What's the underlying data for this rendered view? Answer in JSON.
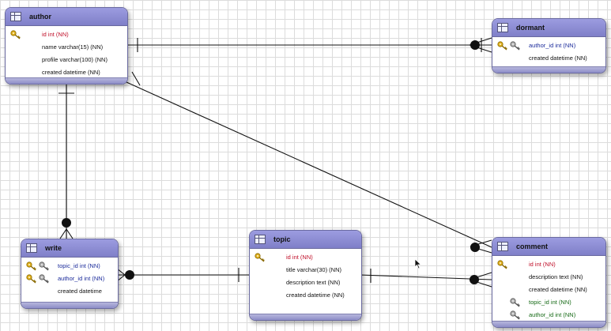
{
  "entities": {
    "author": {
      "title": "author",
      "columns": [
        {
          "text": "id int (NN)",
          "role": "pk"
        },
        {
          "text": "name varchar(15) (NN)",
          "role": "plain"
        },
        {
          "text": "profile varchar(100) (NN)",
          "role": "plain"
        },
        {
          "text": "created datetime (NN)",
          "role": "plain"
        }
      ]
    },
    "dormant": {
      "title": "dormant",
      "columns": [
        {
          "text": "author_id int (NN)",
          "role": "fk"
        },
        {
          "text": "created datetime (NN)",
          "role": "plain"
        }
      ]
    },
    "write": {
      "title": "write",
      "columns": [
        {
          "text": "topic_id int (NN)",
          "role": "fk"
        },
        {
          "text": "author_id int (NN)",
          "role": "fk"
        },
        {
          "text": "created datetime",
          "role": "plain"
        }
      ]
    },
    "topic": {
      "title": "topic",
      "columns": [
        {
          "text": "id int (NN)",
          "role": "pk"
        },
        {
          "text": "title varchar(30) (NN)",
          "role": "plain"
        },
        {
          "text": "description text (NN)",
          "role": "plain"
        },
        {
          "text": "created datetime (NN)",
          "role": "plain"
        }
      ]
    },
    "comment": {
      "title": "comment",
      "columns": [
        {
          "text": "id int (NN)",
          "role": "pk"
        },
        {
          "text": "description text (NN)",
          "role": "plain"
        },
        {
          "text": "created datetime (NN)",
          "role": "plain"
        },
        {
          "text": "topic_id int (NN)",
          "role": "fk2"
        },
        {
          "text": "author_id int (NN)",
          "role": "fk2"
        }
      ]
    }
  },
  "relationships": [
    {
      "from": "author",
      "to": "dormant",
      "type": "one-to-one-or-many"
    },
    {
      "from": "author",
      "to": "write",
      "type": "one-to-many"
    },
    {
      "from": "author",
      "to": "comment",
      "type": "one-to-many"
    },
    {
      "from": "topic",
      "to": "write",
      "type": "one-to-many"
    },
    {
      "from": "topic",
      "to": "comment",
      "type": "one-to-many"
    }
  ],
  "colors": {
    "header": "#8b8bd2",
    "primary_key_text": "#c0102a",
    "foreign_key_text": "#1a2a9a",
    "foreign_key_text_alt": "#166a16",
    "line": "#111111",
    "grid": "#dcdcdc"
  },
  "icons": {
    "table": "table-icon",
    "primary_key": "gold-key-icon",
    "foreign_key": "gray-key-icon"
  }
}
